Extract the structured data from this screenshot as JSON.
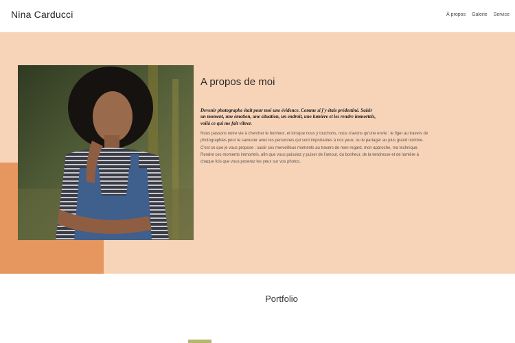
{
  "header": {
    "brand": "Nina Carducci",
    "nav": [
      "À propos",
      "Galerie",
      "Service"
    ]
  },
  "about": {
    "title": "A propos de moi",
    "quote_lines": [
      "Devenir photographe était pour moi une évidence. Comme si j'y étais prédestiné. Saisir",
      "un moment, une émotion, une situation, un endroit, une lumière et les rendre immortels,",
      "voilà ce qui me fait vibrer."
    ],
    "body_lines": [
      "Nous passons notre vie à chercher le bonheur, et lorsque nous y touchons, nous n'avons qu'une envie : le figer au travers de",
      "photographies pour le savourer avec les personnes qui sont importantes à nos yeux, ou le partager au plus grand nombre.",
      "C'est ce que je vous propose : saisir ces merveilleux moments au travers de mon regard, mon approche, ma technique.",
      "Rendre ces moments immortels, afin que vous puissiez y puiser de l'amour, du bonheur, de la tendresse et de lumière à",
      "chaque fois que vous poserez les yeux sur vos photos."
    ]
  },
  "portfolio": {
    "title": "Portfolio"
  },
  "colors": {
    "about_bg": "#f7d3b8",
    "accent": "#e6965f",
    "olive": "#b5b86a"
  }
}
